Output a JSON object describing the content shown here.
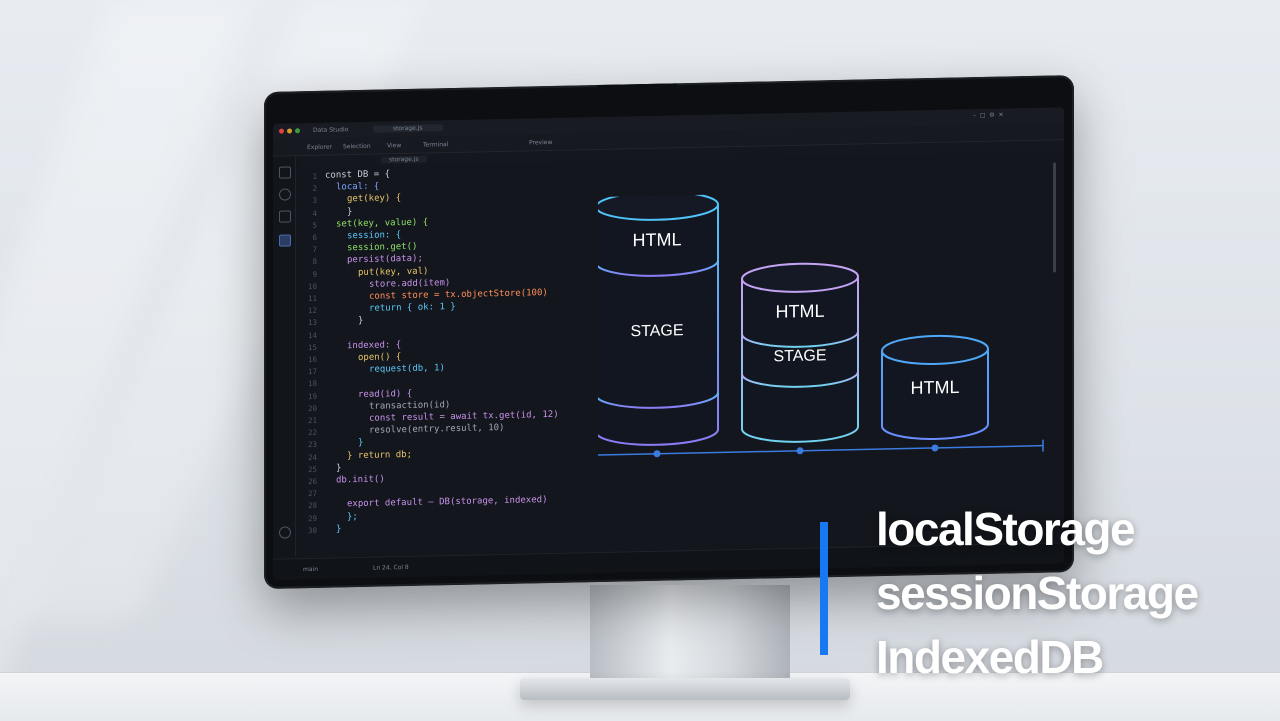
{
  "editor": {
    "window_title": "Data Studio",
    "file_tab": "storage.js",
    "menu": [
      "Explorer",
      "Selection",
      "View",
      "Terminal"
    ],
    "panel_tab": "Preview",
    "breadcrumb": "storage.js",
    "status_left": "main",
    "status_right": "Ln 24, Col 8",
    "code_lines": [
      {
        "n": "1",
        "text": "const DB = {",
        "color": "#c8cdd6",
        "indent": 0
      },
      {
        "n": "2",
        "text": "  local: {",
        "color": "#7aa2ff",
        "indent": 1
      },
      {
        "n": "3",
        "text": "    get(key) {",
        "color": "#e9c46a",
        "indent": 2
      },
      {
        "n": "4",
        "text": "    }",
        "color": "#c8cdd6",
        "indent": 2
      },
      {
        "n": "5",
        "text": "  set(key, value) {",
        "color": "#8ee06a",
        "indent": 1
      },
      {
        "n": "6",
        "text": "    session: {",
        "color": "#5ac8fa",
        "indent": 2
      },
      {
        "n": "7",
        "text": "    session.get()",
        "color": "#8ee06a",
        "indent": 2
      },
      {
        "n": "8",
        "text": "    persist(data);",
        "color": "#c792ea",
        "indent": 2
      },
      {
        "n": "9",
        "text": "      put(key, val)",
        "color": "#e9c46a",
        "indent": 3
      },
      {
        "n": "10",
        "text": "        store.add(item)",
        "color": "#c792ea",
        "indent": 4
      },
      {
        "n": "11",
        "text": "        const store = tx.objectStore(100)",
        "color": "#ff8f5a",
        "indent": 4
      },
      {
        "n": "12",
        "text": "        return { ok: 1 }",
        "color": "#5ac8fa",
        "indent": 4
      },
      {
        "n": "13",
        "text": "      }",
        "color": "#c8cdd6",
        "indent": 3
      },
      {
        "n": "14",
        "text": "",
        "color": "#c8cdd6",
        "indent": 0
      },
      {
        "n": "15",
        "text": "    indexed: {",
        "color": "#c792ea",
        "indent": 2
      },
      {
        "n": "16",
        "text": "      open() {",
        "color": "#e9c46a",
        "indent": 3
      },
      {
        "n": "17",
        "text": "        request(db, 1)",
        "color": "#5ac8fa",
        "indent": 4
      },
      {
        "n": "18",
        "text": "",
        "color": "#c8cdd6",
        "indent": 0
      },
      {
        "n": "19",
        "text": "      read(id) {",
        "color": "#c792ea",
        "indent": 3
      },
      {
        "n": "20",
        "text": "        transaction(id)",
        "color": "#a0a8b6",
        "indent": 4
      },
      {
        "n": "21",
        "text": "        const result = await tx.get(id, 12)",
        "color": "#c792ea",
        "indent": 4
      },
      {
        "n": "22",
        "text": "        resolve(entry.result, 10)",
        "color": "#a0a8b6",
        "indent": 4
      },
      {
        "n": "23",
        "text": "      }",
        "color": "#5ac8fa",
        "indent": 3
      },
      {
        "n": "24",
        "text": "    }  return db;",
        "color": "#e9c46a",
        "indent": 2
      },
      {
        "n": "25",
        "text": "  }",
        "color": "#c8cdd6",
        "indent": 1
      },
      {
        "n": "26",
        "text": "  db.init()",
        "color": "#c792ea",
        "indent": 1
      },
      {
        "n": "27",
        "text": "",
        "color": "#c8cdd6",
        "indent": 0
      },
      {
        "n": "28",
        "text": "    export default — DB(storage, indexed)",
        "color": "#c792ea",
        "indent": 2
      },
      {
        "n": "29",
        "text": "    };",
        "color": "#5ac8fa",
        "indent": 2
      },
      {
        "n": "30",
        "text": "  }",
        "color": "#5ac8fa",
        "indent": 1
      }
    ]
  },
  "diagram": {
    "cylinders": [
      {
        "top_label": "HTML",
        "mid_label": "STAGE",
        "stroke": "#4fc3f7",
        "stroke2": "#8b7cf6"
      },
      {
        "top_label": "HTML",
        "mid_label": "STAGE",
        "stroke": "#c4a3f5",
        "stroke2": "#6fd3f0"
      },
      {
        "top_label": "HTML",
        "mid_label": "",
        "stroke": "#4fa8f7",
        "stroke2": "#6a8cff"
      }
    ],
    "baseline_color": "#3b7be0"
  },
  "overlay": {
    "lines": [
      "localStorage",
      "sessionStorage",
      "IndexedDB"
    ],
    "accent_color": "#1877f2"
  }
}
